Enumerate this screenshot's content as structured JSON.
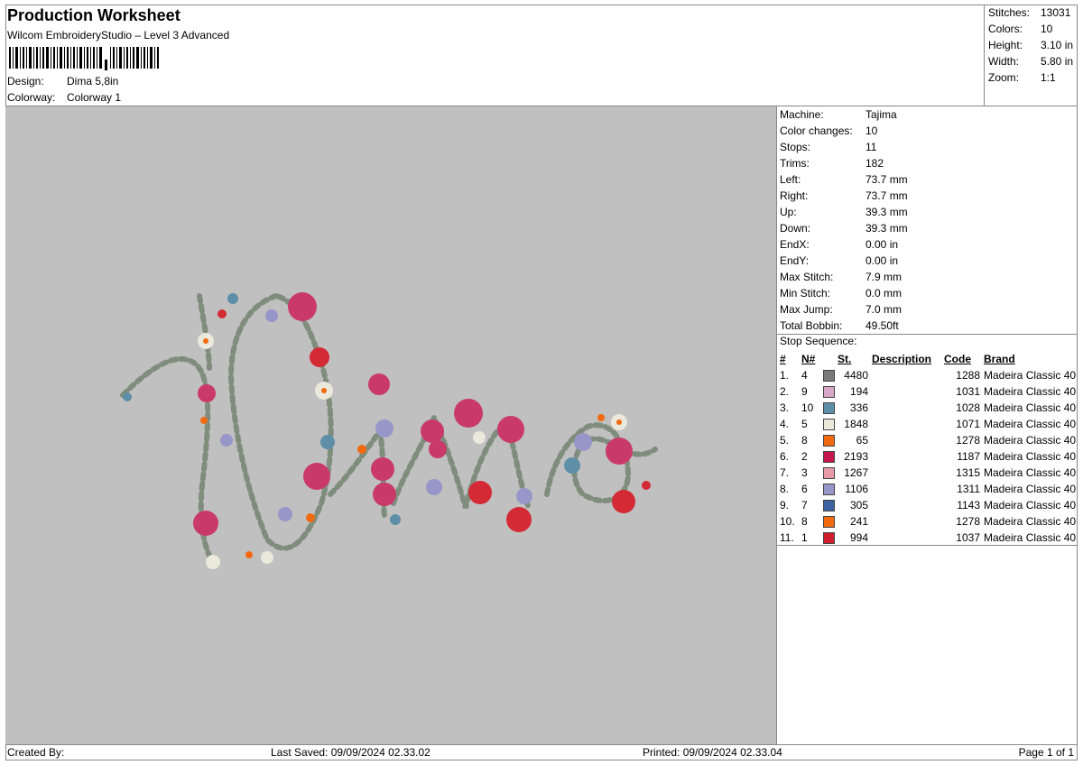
{
  "header": {
    "title": "Production Worksheet",
    "software": "Wilcom EmbroideryStudio – Level 3 Advanced",
    "design_label": "Design:",
    "design_value": "Dima 5,8in",
    "colorway_label": "Colorway:",
    "colorway_value": "Colorway 1"
  },
  "stats": [
    {
      "label": "Stitches:",
      "value": "13031"
    },
    {
      "label": "Colors:",
      "value": "10"
    },
    {
      "label": "Height:",
      "value": "3.10 in"
    },
    {
      "label": "Width:",
      "value": "5.80 in"
    },
    {
      "label": "Zoom:",
      "value": "1:1"
    }
  ],
  "machine_info": [
    {
      "label": "Machine:",
      "value": "Tajima"
    },
    {
      "label": "Color changes:",
      "value": "10"
    },
    {
      "label": "Stops:",
      "value": "11"
    },
    {
      "label": "Trims:",
      "value": "182"
    },
    {
      "label": "Left:",
      "value": "73.7 mm"
    },
    {
      "label": "Right:",
      "value": "73.7 mm"
    },
    {
      "label": "Up:",
      "value": "39.3 mm"
    },
    {
      "label": "Down:",
      "value": "39.3 mm"
    },
    {
      "label": "EndX:",
      "value": "0.00 in"
    },
    {
      "label": "EndY:",
      "value": "0.00 in"
    },
    {
      "label": "Max Stitch:",
      "value": "7.9 mm"
    },
    {
      "label": "Min Stitch:",
      "value": "0.0 mm"
    },
    {
      "label": "Max Jump:",
      "value": "7.0 mm"
    },
    {
      "label": "Total Bobbin:",
      "value": "49.50ft"
    }
  ],
  "stop_sequence": {
    "caption": "Stop Sequence:",
    "headers": {
      "idx": "#",
      "n": "N#",
      "st": "St.",
      "desc": "Description",
      "code": "Code",
      "brand": "Brand"
    },
    "rows": [
      {
        "idx": "1.",
        "n": "4",
        "color": "#7a7a7a",
        "st": "4480",
        "desc": "",
        "code": "1288",
        "brand": "Madeira Classic 40"
      },
      {
        "idx": "2.",
        "n": "9",
        "color": "#d8a6c8",
        "st": "194",
        "desc": "",
        "code": "1031",
        "brand": "Madeira Classic 40"
      },
      {
        "idx": "3.",
        "n": "10",
        "color": "#5e8ea8",
        "st": "336",
        "desc": "",
        "code": "1028",
        "brand": "Madeira Classic 40"
      },
      {
        "idx": "4.",
        "n": "5",
        "color": "#ebe8dc",
        "st": "1848",
        "desc": "",
        "code": "1071",
        "brand": "Madeira Classic 40"
      },
      {
        "idx": "5.",
        "n": "8",
        "color": "#f26a10",
        "st": "65",
        "desc": "",
        "code": "1278",
        "brand": "Madeira Classic 40"
      },
      {
        "idx": "6.",
        "n": "2",
        "color": "#c4174e",
        "st": "2193",
        "desc": "",
        "code": "1187",
        "brand": "Madeira Classic 40"
      },
      {
        "idx": "7.",
        "n": "3",
        "color": "#e89aa8",
        "st": "1267",
        "desc": "",
        "code": "1315",
        "brand": "Madeira Classic 40"
      },
      {
        "idx": "8.",
        "n": "6",
        "color": "#9796c8",
        "st": "1106",
        "desc": "",
        "code": "1311",
        "brand": "Madeira Classic 40"
      },
      {
        "idx": "9.",
        "n": "7",
        "color": "#3d64a0",
        "st": "305",
        "desc": "",
        "code": "1143",
        "brand": "Madeira Classic 40"
      },
      {
        "idx": "10.",
        "n": "8",
        "color": "#f26a10",
        "st": "241",
        "desc": "",
        "code": "1278",
        "brand": "Madeira Classic 40"
      },
      {
        "idx": "11.",
        "n": "1",
        "color": "#d01e2e",
        "st": "994",
        "desc": "",
        "code": "1037",
        "brand": "Madeira Classic 40"
      }
    ]
  },
  "footer": {
    "created_by": "Created By:",
    "last_saved": "Last Saved: 09/09/2024 02.33.02",
    "printed": "Printed: 09/09/2024 02.33.04",
    "page": "Page 1 of 1"
  },
  "colors": {
    "canvas_bg": "#c0c0c0",
    "rose": "#c93a6a",
    "red_rose": "#d42a36",
    "leaf": "#8a9a86",
    "cream": "#ebe8dc",
    "lilac": "#9796c8",
    "orange": "#f26a10"
  }
}
